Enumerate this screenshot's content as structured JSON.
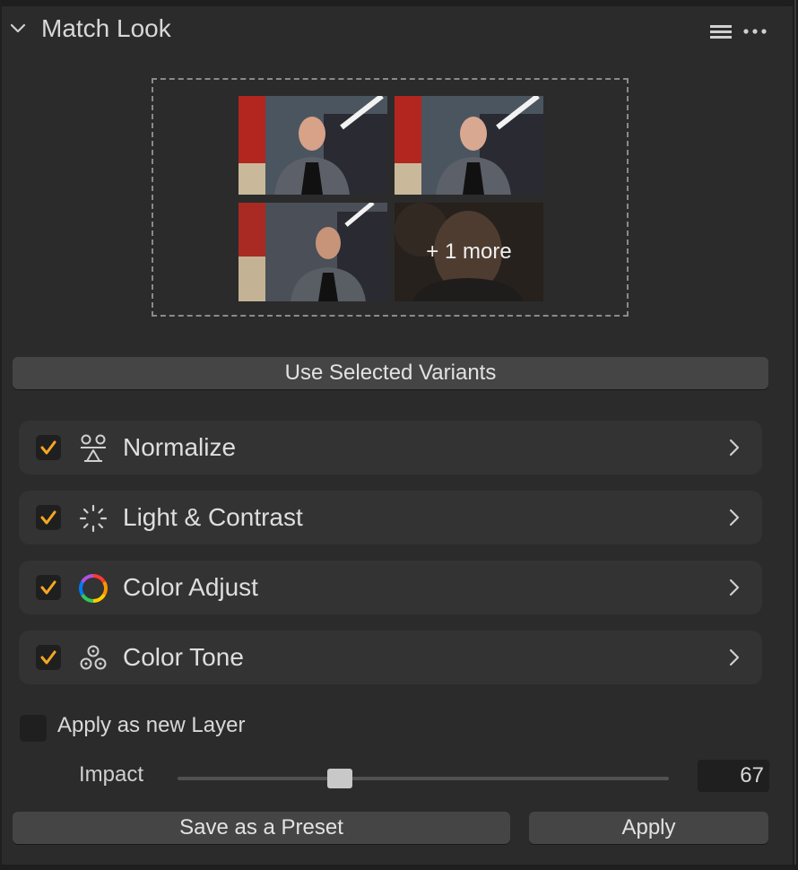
{
  "panel": {
    "title": "Match Look",
    "menu_icon": "list-icon",
    "more_icon": "ellipsis-icon"
  },
  "variants": {
    "thumbnails": [
      {
        "name": "variant-1"
      },
      {
        "name": "variant-2"
      },
      {
        "name": "variant-3"
      }
    ],
    "more_label": "+ 1 more",
    "use_selected_label": "Use Selected Variants"
  },
  "adjustments": [
    {
      "label": "Normalize",
      "icon": "normalize-icon",
      "checked": true
    },
    {
      "label": "Light & Contrast",
      "icon": "light-contrast-icon",
      "checked": true
    },
    {
      "label": "Color Adjust",
      "icon": "color-wheel-icon",
      "checked": true
    },
    {
      "label": "Color Tone",
      "icon": "color-tone-icon",
      "checked": true
    }
  ],
  "layer": {
    "label": "Apply as new Layer",
    "checked": false
  },
  "impact": {
    "label": "Impact",
    "value": "67",
    "level_fraction": 0.33
  },
  "actions": {
    "save_preset_label": "Save as a Preset",
    "apply_label": "Apply"
  },
  "colors": {
    "background": "#2b2b2b",
    "row_background": "#333333",
    "button": "#454545",
    "check_accent": "#f5a623"
  }
}
